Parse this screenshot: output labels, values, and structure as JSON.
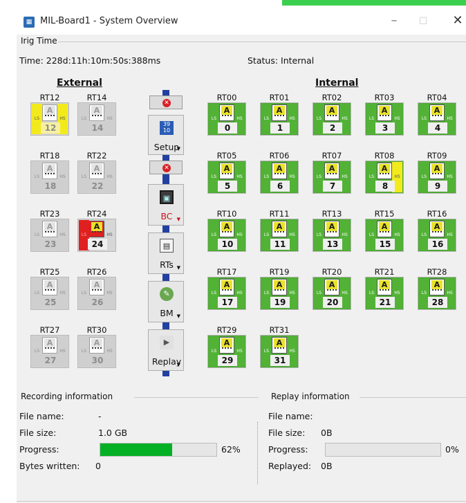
{
  "window": {
    "title": "MIL-Board1 - System Overview",
    "app_icon": "board-icon",
    "min": "–",
    "max": "□",
    "close": "✕"
  },
  "irig": {
    "group": "Irig Time",
    "time": "Time:  228d:11h:10m:50s:388ms",
    "status": "Status:  Internal"
  },
  "external": {
    "heading": "External",
    "rts": [
      {
        "label": "RT12",
        "num": "12",
        "state": "yellow"
      },
      {
        "label": "RT14",
        "num": "14",
        "state": "off"
      },
      {
        "label": "RT18",
        "num": "18",
        "state": "off"
      },
      {
        "label": "RT22",
        "num": "22",
        "state": "off"
      },
      {
        "label": "RT23",
        "num": "23",
        "state": "off"
      },
      {
        "label": "RT24",
        "num": "24",
        "state": "red"
      },
      {
        "label": "RT25",
        "num": "25",
        "state": "off"
      },
      {
        "label": "RT26",
        "num": "26",
        "state": "off"
      },
      {
        "label": "RT27",
        "num": "27",
        "state": "off"
      },
      {
        "label": "RT30",
        "num": "30",
        "state": "off"
      }
    ]
  },
  "internal": {
    "heading": "Internal",
    "rts": [
      {
        "label": "RT00",
        "num": "0"
      },
      {
        "label": "RT01",
        "num": "1"
      },
      {
        "label": "RT02",
        "num": "2"
      },
      {
        "label": "RT03",
        "num": "3"
      },
      {
        "label": "RT04",
        "num": "4"
      },
      {
        "label": "RT05",
        "num": "5"
      },
      {
        "label": "RT06",
        "num": "6"
      },
      {
        "label": "RT07",
        "num": "7"
      },
      {
        "label": "RT08",
        "num": "8"
      },
      {
        "label": "RT09",
        "num": "9"
      },
      {
        "label": "RT10",
        "num": "10"
      },
      {
        "label": "RT11",
        "num": "11"
      },
      {
        "label": "RT13",
        "num": "13"
      },
      {
        "label": "RT15",
        "num": "15"
      },
      {
        "label": "RT16",
        "num": "16"
      },
      {
        "label": "RT17",
        "num": "17"
      },
      {
        "label": "RT19",
        "num": "19"
      },
      {
        "label": "RT20",
        "num": "20"
      },
      {
        "label": "RT21",
        "num": "21"
      },
      {
        "label": "RT28",
        "num": "28"
      },
      {
        "label": "RT29",
        "num": "29"
      },
      {
        "label": "RT31",
        "num": "31"
      }
    ]
  },
  "rt_common": {
    "ls": "LS",
    "hs": "HS",
    "icon_letter": "A"
  },
  "controls": {
    "setup": {
      "label": "Setup",
      "glyph": "39\n10",
      "icon": "calendar-icon"
    },
    "bc": {
      "label": "BC",
      "icon": "bus-controller-icon"
    },
    "rts": {
      "label": "RTs",
      "icon": "terminal-icon"
    },
    "bm": {
      "label": "BM",
      "icon": "monitor-icon"
    },
    "replay": {
      "label": "Replay",
      "icon": "replay-icon"
    },
    "connector_icon": "disconnect-icon"
  },
  "recording": {
    "group": "Recording information",
    "file_name_label": "File name:",
    "file_name": "-",
    "file_size_label": "File size:",
    "file_size": "1.0 GB",
    "progress_label": "Progress:",
    "progress_percent": 62,
    "progress_text": "62%",
    "bytes_label": "Bytes written:",
    "bytes": "0"
  },
  "replay": {
    "group": "Replay information",
    "file_name_label": "File name:",
    "file_name": "",
    "file_size_label": "File size:",
    "file_size": "0B",
    "progress_label": "Progress:",
    "progress_percent": 0,
    "progress_text": "0%",
    "replayed_label": "Replayed:",
    "replayed": "0B"
  },
  "colors": {
    "green": "#4da833",
    "yellow": "#f2ea1d",
    "red": "#e02020",
    "progress": "#06b025"
  }
}
